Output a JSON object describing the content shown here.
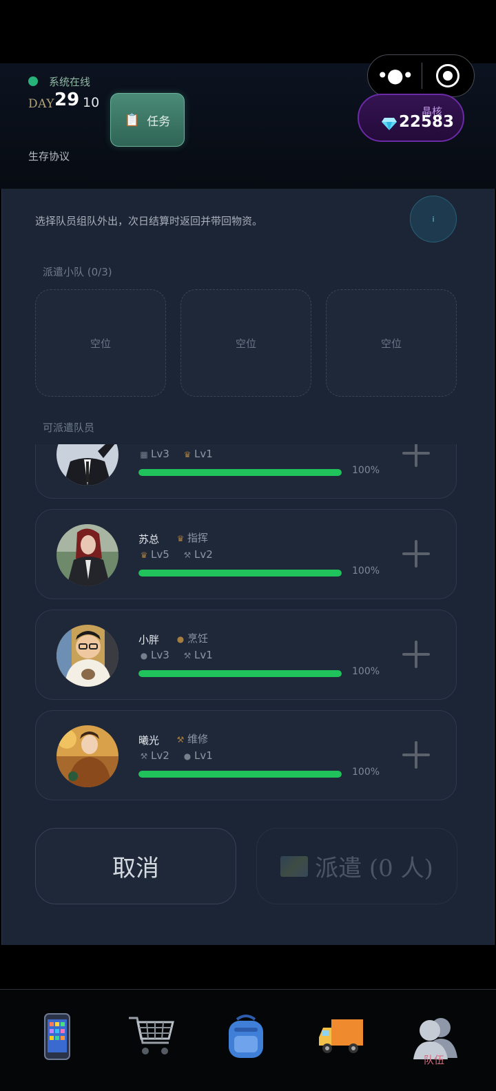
{
  "header": {
    "status_text": "系统在线",
    "day_label": "DAY",
    "day_number": "29",
    "hour": "10",
    "task_label": "任务",
    "protocol_label": "生存协议",
    "crystal_label": "晶核",
    "crystal_value": "22583"
  },
  "panel": {
    "description": "选择队员组队外出，次日结算时返回并带回物资。",
    "info_label": "i",
    "squad_title": "派遣小队 (0/3)",
    "slots": [
      "空位",
      "空位",
      "空位"
    ],
    "members_title": "可派遣队员"
  },
  "members": [
    {
      "name": "",
      "role": "",
      "lv1": "Lv3",
      "lv2": "Lv1",
      "percent": "100%",
      "stamina": 1.0
    },
    {
      "name": "苏总",
      "role": "指挥",
      "lv1": "Lv5",
      "lv2": "Lv2",
      "percent": "100%",
      "stamina": 1.0
    },
    {
      "name": "小胖",
      "role": "烹饪",
      "lv1": "Lv3",
      "lv2": "Lv1",
      "percent": "100%",
      "stamina": 1.0
    },
    {
      "name": "曦光",
      "role": "维修",
      "lv1": "Lv2",
      "lv2": "Lv1",
      "percent": "100%",
      "stamina": 1.0
    }
  ],
  "actions": {
    "cancel_label": "取消",
    "dispatch_label": "派遣 (0 人)"
  },
  "nav": {
    "items": [
      "phone-icon",
      "shopping-cart-icon",
      "backpack-icon",
      "delivery-truck-icon",
      "team-icon"
    ],
    "active_label": "队伍"
  },
  "colors": {
    "accent_green": "#20c25c",
    "crystal_purple": "#6b2ba6",
    "active_nav": "#d76a7d"
  }
}
